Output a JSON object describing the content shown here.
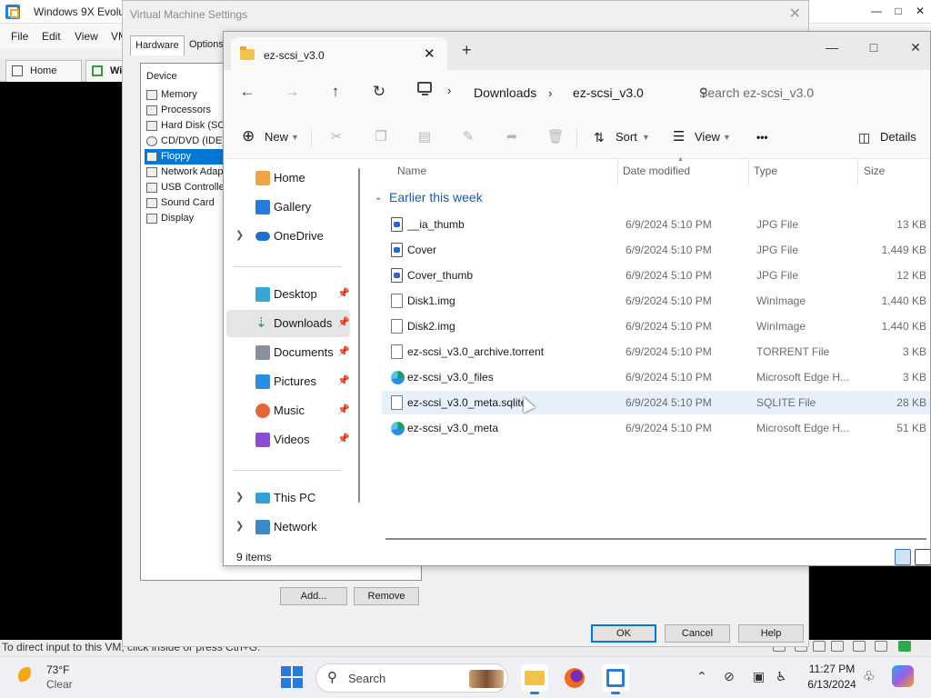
{
  "vmware": {
    "title": "Windows 9X Evolu",
    "menu": [
      "File",
      "Edit",
      "View",
      "VM"
    ],
    "tabs": [
      {
        "label": "Home"
      },
      {
        "label": "Wi"
      }
    ],
    "status": "To direct input to this VM, click inside or press Ctrl+G."
  },
  "settings": {
    "title": "Virtual Machine Settings",
    "tabs": [
      "Hardware",
      "Options"
    ],
    "device_header": "Device",
    "devices": [
      "Memory",
      "Processors",
      "Hard Disk (SCSI)",
      "CD/DVD (IDE)",
      "Floppy",
      "Network Adapter",
      "USB Controller",
      "Sound Card",
      "Display"
    ],
    "selected_device": "Floppy",
    "buttons": {
      "add": "Add...",
      "remove": "Remove",
      "ok": "OK",
      "cancel": "Cancel",
      "help": "Help"
    }
  },
  "explorer": {
    "tab_title": "ez-scsi_v3.0",
    "breadcrumb": [
      "Downloads",
      "ez-scsi_v3.0"
    ],
    "search_placeholder": "Search ez-scsi_v3.0",
    "commands": {
      "new": "New",
      "sort": "Sort",
      "view": "View",
      "more": "•••",
      "details": "Details"
    },
    "nav": {
      "home": "Home",
      "gallery": "Gallery",
      "onedrive": "OneDrive",
      "desktop": "Desktop",
      "downloads": "Downloads",
      "documents": "Documents",
      "pictures": "Pictures",
      "music": "Music",
      "videos": "Videos",
      "thispc": "This PC",
      "network": "Network"
    },
    "columns": {
      "name": "Name",
      "date": "Date modified",
      "type": "Type",
      "size": "Size"
    },
    "group": "Earlier this week",
    "files": [
      {
        "name": "__ia_thumb",
        "date": "6/9/2024 5:10 PM",
        "type": "JPG File",
        "size": "13 KB",
        "icon": "jpg"
      },
      {
        "name": "Cover",
        "date": "6/9/2024 5:10 PM",
        "type": "JPG File",
        "size": "1,449 KB",
        "icon": "jpg"
      },
      {
        "name": "Cover_thumb",
        "date": "6/9/2024 5:10 PM",
        "type": "JPG File",
        "size": "12 KB",
        "icon": "jpg"
      },
      {
        "name": "Disk1.img",
        "date": "6/9/2024 5:10 PM",
        "type": "WinImage",
        "size": "1,440 KB",
        "icon": "file"
      },
      {
        "name": "Disk2.img",
        "date": "6/9/2024 5:10 PM",
        "type": "WinImage",
        "size": "1,440 KB",
        "icon": "file"
      },
      {
        "name": "ez-scsi_v3.0_archive.torrent",
        "date": "6/9/2024 5:10 PM",
        "type": "TORRENT File",
        "size": "3 KB",
        "icon": "file"
      },
      {
        "name": "ez-scsi_v3.0_files",
        "date": "6/9/2024 5:10 PM",
        "type": "Microsoft Edge H...",
        "size": "3 KB",
        "icon": "edge"
      },
      {
        "name": "ez-scsi_v3.0_meta.sqlite",
        "date": "6/9/2024 5:10 PM",
        "type": "SQLITE File",
        "size": "28 KB",
        "icon": "file"
      },
      {
        "name": "ez-scsi_v3.0_meta",
        "date": "6/9/2024 5:10 PM",
        "type": "Microsoft Edge H...",
        "size": "51 KB",
        "icon": "edge"
      }
    ],
    "item_count": "9 items"
  },
  "taskbar": {
    "temp": "73°F",
    "condition": "Clear",
    "search_label": "Search",
    "time": "11:27 PM",
    "date": "6/13/2024"
  }
}
